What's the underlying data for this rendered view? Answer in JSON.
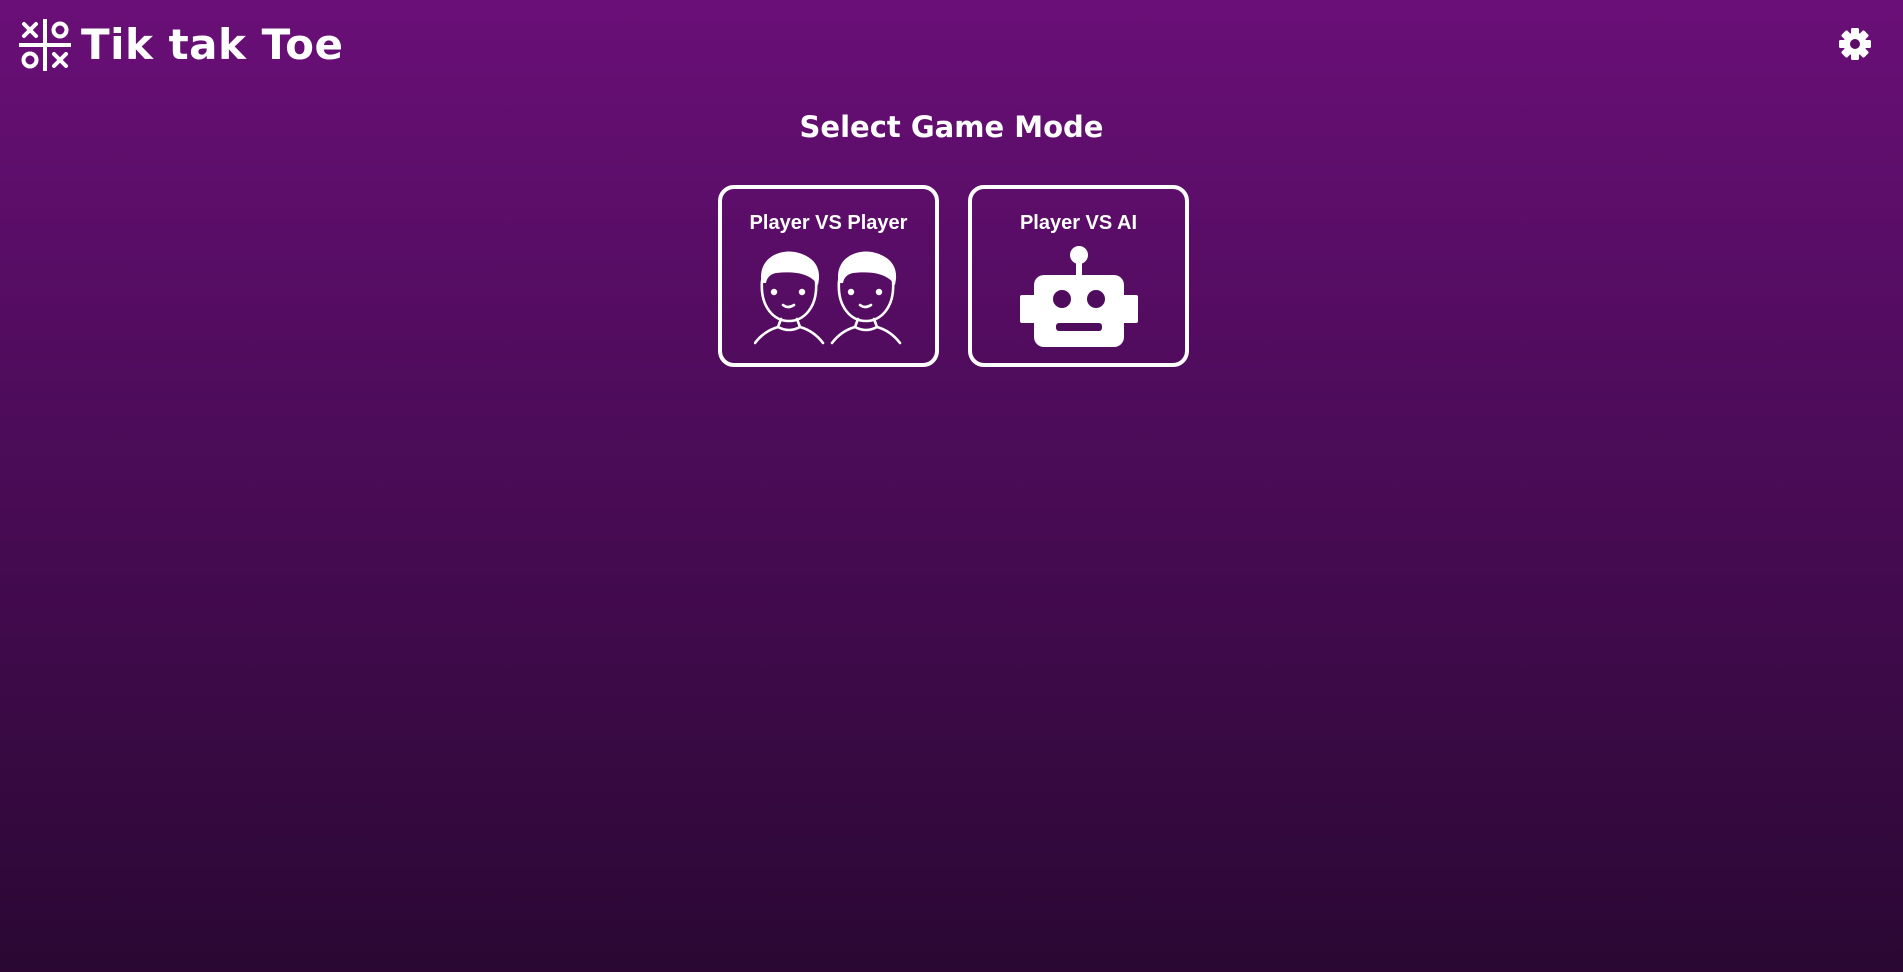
{
  "header": {
    "title": "Tik tak Toe",
    "logo_icon": "tic-tac-toe-board-icon",
    "settings_icon": "gear-icon"
  },
  "main": {
    "heading": "Select Game Mode",
    "modes": [
      {
        "label": "Player VS Player",
        "icon": "two-players-icon"
      },
      {
        "label": "Player VS AI",
        "icon": "robot-icon"
      }
    ]
  },
  "colors": {
    "background_top": "#6a0f78",
    "background_bottom": "#2a0833",
    "foreground": "#ffffff"
  }
}
